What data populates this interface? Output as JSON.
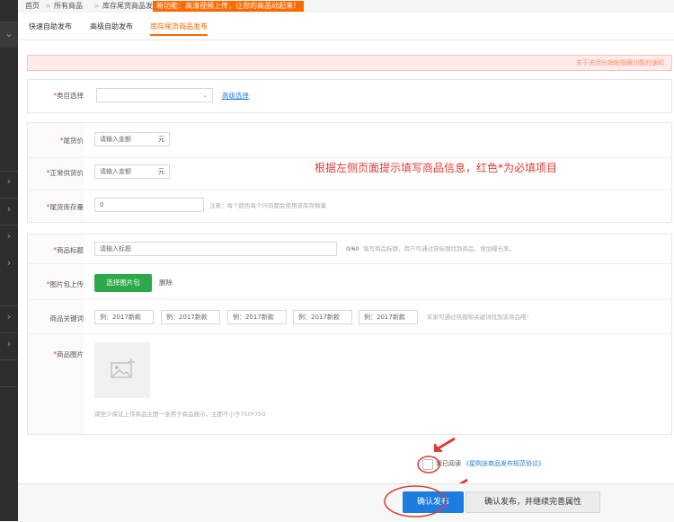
{
  "breadcrumb": {
    "home": "首页",
    "all_products": "所有商品",
    "current": "库存尾货商品发布",
    "notice_badge": "新功能：高清视频上传，让您的商品动起来！"
  },
  "tabs": [
    {
      "label": "快速自助发布"
    },
    {
      "label": "高级自助发布"
    },
    {
      "label": "库存尾货商品发布"
    }
  ],
  "notify_bar": {
    "text": "关于关闭分销帐隐藏功能的通知"
  },
  "category": {
    "label": "*类目选择",
    "advanced_link": "高级选择"
  },
  "price": {
    "tail_price": {
      "label": "*尾货价",
      "placeholder": "请输入金额",
      "unit": "元"
    },
    "normal_price": {
      "label": "*正常供货价",
      "placeholder": "请输入金额",
      "unit": "元"
    },
    "stock": {
      "label": "*尾货库存量",
      "value": "0",
      "hint": "注意：每个颜色每个尺码都会使用该库存数量"
    }
  },
  "annotation": "根据左侧页面提示填写商品信息，红色*为必填项目",
  "product": {
    "title": {
      "label": "*商品标题",
      "placeholder": "请输入标题",
      "counter": "0/60",
      "hint": "填写商品标题，用户可通过该标题找到商品，增加曝光率。"
    },
    "images_pack": {
      "label": "*图片包上传",
      "button": "选择图片包",
      "delete": "删除"
    },
    "keywords": {
      "label": "商品关键词",
      "placeholders": [
        "例：2017新款",
        "例：2017新款",
        "例：2017新款",
        "例：2017新款",
        "例：2017新款"
      ],
      "hint": "买家可通过热搜和关键词找到该商品哦！"
    },
    "images": {
      "label": "*商品图片",
      "hint": "请至少保证上传商品主图一张用于商品展示，主图不小于750*750"
    }
  },
  "agreement": {
    "prefix": "我已阅读",
    "link": "《星购途商品发布规范协议》"
  },
  "bottom": {
    "publish": "确认发布",
    "publish_more": "确认发布，并继续完善属性"
  },
  "colors": {
    "accent": "#ff6a00",
    "required": "#ff3b30",
    "primary_blue": "#1c7ce0",
    "green": "#2da84a",
    "annotation_red": "#e03c31"
  }
}
